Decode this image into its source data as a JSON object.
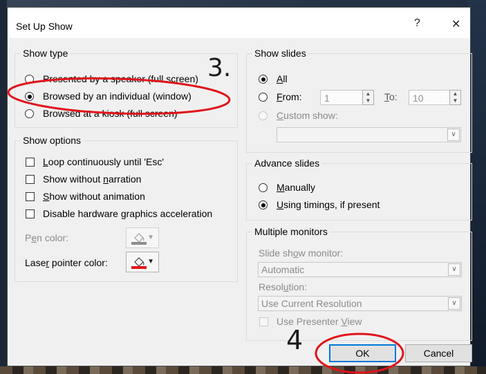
{
  "dialog": {
    "title": "Set Up Show",
    "help_glyph": "?",
    "close_glyph": "✕"
  },
  "show_type": {
    "label": "Show type",
    "options": [
      {
        "label": "Presented by a speaker (full screen)",
        "selected": false
      },
      {
        "label": "Browsed by an individual (window)",
        "selected": true
      },
      {
        "label": "Browsed at a kiosk (full screen)",
        "selected": false
      }
    ]
  },
  "show_options": {
    "label": "Show options",
    "items": [
      {
        "pre": "",
        "key": "L",
        "post": "oop continuously until 'Esc'",
        "checked": false
      },
      {
        "pre": "Show without ",
        "key": "n",
        "post": "arration",
        "checked": false
      },
      {
        "pre": "",
        "key": "S",
        "post": "how without animation",
        "checked": false
      },
      {
        "pre": "Disable hardware ",
        "key": "g",
        "post": "raphics acceleration",
        "checked": false
      }
    ],
    "pen_color": {
      "pre": "P",
      "key": "e",
      "post": "n color:"
    },
    "laser_color": {
      "pre": "Lase",
      "key": "r",
      "post": " pointer color:"
    }
  },
  "show_slides": {
    "label": "Show slides",
    "all": {
      "key": "A",
      "post": "ll"
    },
    "from": {
      "key": "F",
      "post": "rom:",
      "value": "1"
    },
    "to": {
      "key": "T",
      "post": "o:",
      "value": "10"
    },
    "custom": {
      "pre": "",
      "key": "C",
      "post": "ustom show:",
      "value": ""
    }
  },
  "advance_slides": {
    "label": "Advance slides",
    "manually": {
      "key": "M",
      "post": "anually"
    },
    "timings": {
      "key": "U",
      "post": "sing timings, if present"
    }
  },
  "monitors": {
    "label": "Multiple monitors",
    "monitor_label": {
      "pre": "Slide sh",
      "key": "o",
      "post": "w monitor:"
    },
    "monitor_value": "Automatic",
    "resolution_label": {
      "pre": "Resol",
      "key": "u",
      "post": "tion:"
    },
    "resolution_value": "Use Current Resolution",
    "presenter": {
      "pre": "Use Presenter ",
      "key": "V",
      "post": "iew"
    }
  },
  "buttons": {
    "ok": "OK",
    "cancel": "Cancel"
  },
  "annotations": {
    "step3": "3.",
    "step4": "4",
    "color": "#e0131b"
  },
  "colors": {
    "laser_red": "#e0131b",
    "pen_gray": "#8c8c8c",
    "accent": "#0078d7"
  }
}
